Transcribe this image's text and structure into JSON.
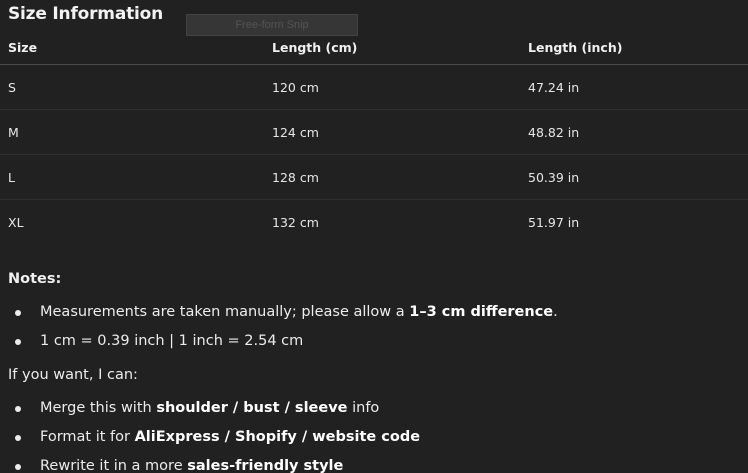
{
  "title": "Size Information",
  "overlay": {
    "label": "Free-form Snip"
  },
  "table": {
    "headers": [
      "Size",
      "Length (cm)",
      "Length (inch)"
    ],
    "rows": [
      [
        "S",
        "120 cm",
        "47.24 in"
      ],
      [
        "M",
        "124 cm",
        "48.82 in"
      ],
      [
        "L",
        "128 cm",
        "50.39 in"
      ],
      [
        "XL",
        "132 cm",
        "51.97 in"
      ]
    ]
  },
  "notes": {
    "heading": "Notes:",
    "items": [
      {
        "pre": "Measurements are taken manually; please allow a ",
        "bold": "1–3 cm difference",
        "post": "."
      },
      {
        "pre": "1 cm = 0.39 inch | 1 inch = 2.54 cm",
        "bold": "",
        "post": ""
      }
    ]
  },
  "offer": {
    "intro": "If you want, I can:",
    "items": [
      {
        "pre": "Merge this with ",
        "bold": "shoulder / bust / sleeve",
        "post": " info"
      },
      {
        "pre": "Format it for ",
        "bold": "AliExpress / Shopify / website code",
        "post": ""
      },
      {
        "pre": "Rewrite it in a more ",
        "bold": "sales-friendly style",
        "post": ""
      }
    ]
  }
}
